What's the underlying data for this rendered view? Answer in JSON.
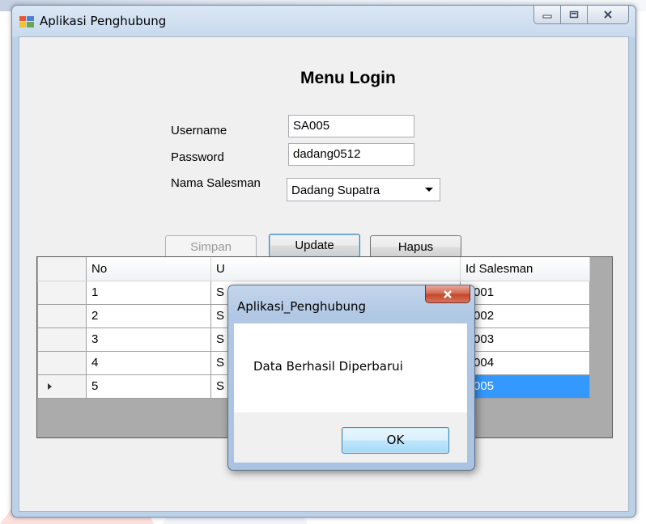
{
  "window": {
    "title": "Aplikasi Penghubung"
  },
  "form": {
    "title": "Menu Login",
    "username_label": "Username",
    "username_value": "SA005",
    "password_label": "Password",
    "password_value": "dadang0512",
    "salesman_label": "Nama Salesman",
    "salesman_value": "Dadang Supatra",
    "btn_simpan": "Simpan",
    "btn_update": "Update",
    "btn_hapus": "Hapus"
  },
  "grid": {
    "columns": [
      "No",
      "U",
      "Id Salesman"
    ],
    "rows": [
      {
        "no": "1",
        "user": "S",
        "id": "S001"
      },
      {
        "no": "2",
        "user": "S",
        "id": "S002"
      },
      {
        "no": "3",
        "user": "S",
        "id": "S003"
      },
      {
        "no": "4",
        "user": "S",
        "id": "S004"
      },
      {
        "no": "5",
        "user": "S",
        "id": "S005"
      }
    ],
    "selected_row": 5
  },
  "dialog": {
    "title": "Aplikasi_Penghubung",
    "message": "Data Berhasil Diperbarui",
    "ok_label": "OK"
  },
  "colors": {
    "selection": "#3399ff",
    "title_bar": "#c9daee",
    "close_button": "#c4462c"
  },
  "icons": [
    "app-icon",
    "minimize-icon",
    "maximize-icon",
    "close-icon",
    "row-pointer-icon",
    "dropdown-arrow-icon"
  ]
}
